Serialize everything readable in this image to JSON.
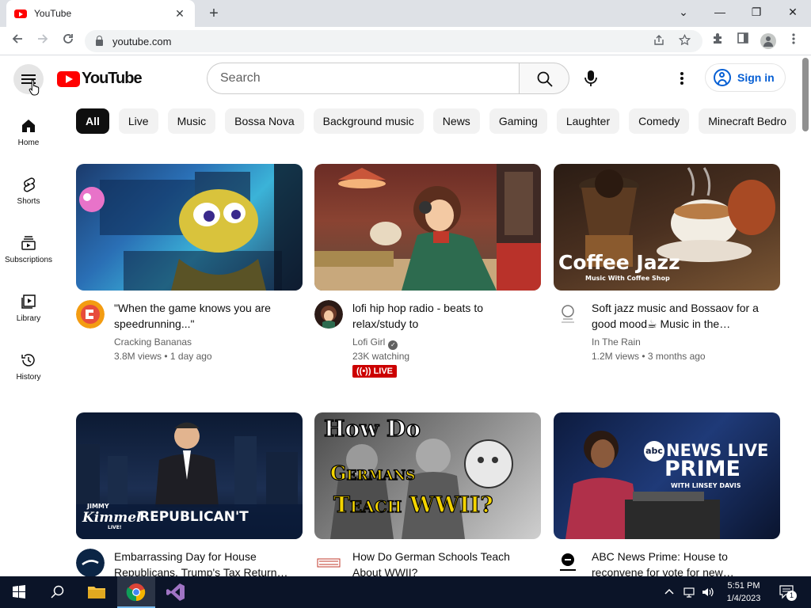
{
  "browser": {
    "tab_title": "YouTube",
    "tab_close": "✕",
    "new_tab": "+",
    "url": "youtube.com",
    "window_controls": {
      "tab_search": "⌄",
      "minimize": "—",
      "restore": "❐",
      "close": "✕"
    }
  },
  "masthead": {
    "logo_text": "YouTube",
    "search_placeholder": "Search",
    "sign_in_label": "Sign in"
  },
  "chips": [
    "All",
    "Live",
    "Music",
    "Bossa Nova",
    "Background music",
    "News",
    "Gaming",
    "Laughter",
    "Comedy",
    "Minecraft Bedro"
  ],
  "guide": [
    {
      "label": "Home",
      "icon": "home-icon"
    },
    {
      "label": "Shorts",
      "icon": "shorts-icon"
    },
    {
      "label": "Subscriptions",
      "icon": "subscriptions-icon"
    },
    {
      "label": "Library",
      "icon": "library-icon"
    },
    {
      "label": "History",
      "icon": "history-icon"
    }
  ],
  "videos": [
    {
      "title": "\"When the game knows you are speedrunning...\"",
      "channel": "Cracking Bananas",
      "stats": "3.8M views • 1 day ago"
    },
    {
      "title": "lofi hip hop radio - beats to relax/study to",
      "channel": "Lofi Girl",
      "stats": "23K watching",
      "badge": "LIVE"
    },
    {
      "title": "Soft jazz music and Bossaov for a good mood☕ Music in the…",
      "channel": "In The Rain",
      "stats": "1.2M views • 3 months ago",
      "thumb_title": "Coffee Jazz",
      "thumb_subtitle": "Music With Coffee Shop"
    },
    {
      "title": "Embarrassing Day for House Republicans, Trump's Tax Return…",
      "thumb_text": "REPUBLICAN'T",
      "thumb_logo_top": "JIMMY",
      "thumb_logo_main": "Kimmel",
      "thumb_logo_bottom": "LIVE!"
    },
    {
      "title": "How Do German Schools Teach About WWII?",
      "thumb_line1": "How Do",
      "thumb_line2": "Germans",
      "thumb_line3": "Teach WWII?"
    },
    {
      "title": "ABC News Prime: House to reconvene for vote for new…",
      "thumb_brand": "abc",
      "thumb_line1": "NEWS LIVE",
      "thumb_line2": "PRIME",
      "thumb_line3": "WITH LINSEY DAVIS"
    }
  ],
  "taskbar": {
    "time": "5:51 PM",
    "date": "1/4/2023",
    "notifications": "1"
  },
  "colors": {
    "brand_red": "#ff0000",
    "link_blue": "#065fd4",
    "live_red": "#cc0000",
    "taskbar": "#0b1428"
  }
}
